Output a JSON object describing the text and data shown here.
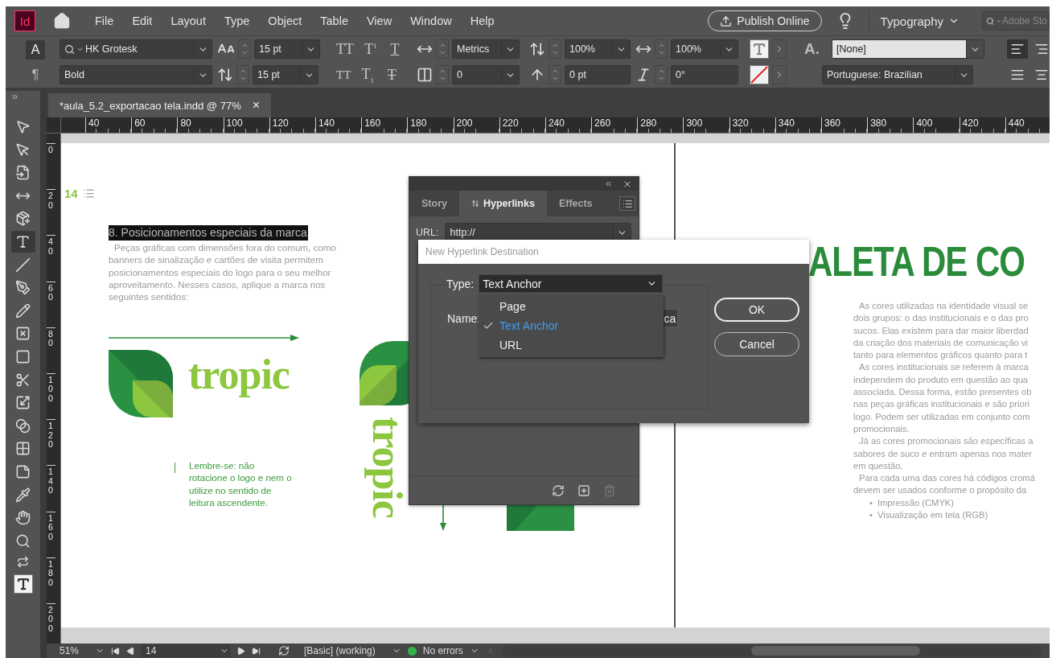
{
  "menubar": {
    "logo": "Id",
    "menus": [
      "File",
      "Edit",
      "Layout",
      "Type",
      "Object",
      "Table",
      "View",
      "Window",
      "Help"
    ],
    "publish_button": "Publish Online",
    "workspace": "Typography",
    "search": {
      "placeholder": "Adobe Sto"
    }
  },
  "control_panel": {
    "modes": [
      {
        "label": "A",
        "selected": true
      },
      {
        "label": "¶",
        "selected": false
      }
    ],
    "font_family": "HK Grotesk",
    "font_style": "Bold",
    "font_size": "15 pt",
    "leading": "15 pt",
    "type_buttons": [
      {
        "label": "TT",
        "kind": "caps"
      },
      {
        "label": "T$^{1}$",
        "kind": "super"
      },
      {
        "label": "T",
        "kind": "underline"
      },
      {
        "label": "TT",
        "kind": "smallcaps"
      },
      {
        "label": "T$_{1}$",
        "kind": "sub"
      },
      {
        "label": "T",
        "kind": "strike"
      }
    ],
    "kerning": "Metrics",
    "tracking": "0",
    "vertical_scale": "100%",
    "baseline_shift": "0 pt",
    "horizontal_scale": "100%",
    "skew": "0°",
    "style_glyph": "A.",
    "character_style": "[None]",
    "language": "Portuguese: Brazilian"
  },
  "document_tab": {
    "title": "*aula_5.2_exportacao tela.indd @ 77%",
    "close": "×"
  },
  "rulers": {
    "horizontal": [
      "40",
      "60",
      "80",
      "100",
      "120",
      "140",
      "160",
      "180",
      "200",
      "220",
      "240",
      "260",
      "280",
      "300",
      "320",
      "340",
      "360",
      "380",
      "400",
      "420",
      "440"
    ],
    "vertical": [
      "0",
      "20",
      "40",
      "60",
      "80",
      "100",
      "120",
      "140",
      "160",
      "180",
      "200"
    ]
  },
  "tools": [
    {
      "selected": false
    },
    {
      "selected": false
    },
    {
      "selected": false
    },
    {
      "selected": false
    },
    {
      "selected": false
    },
    {
      "selected": true
    },
    {
      "selected": false
    },
    {
      "selected": false
    },
    {
      "selected": false
    },
    {
      "selected": false
    },
    {
      "selected": false
    },
    {
      "selected": false
    },
    {
      "selected": false
    },
    {
      "selected": false
    },
    {
      "selected": false
    },
    {
      "selected": false
    },
    {
      "selected": false
    },
    {
      "selected": false
    },
    {
      "selected": false
    }
  ],
  "left_page": {
    "page_number": "14",
    "heading": "8. Posicionamentos especiais da marca",
    "body": "Peças gráficas com dimensões fora do comum, como banners de sinalização e cartões de visita permitem posicionamentos especiais do logo para o seu melhor aproveitamento. Nesses casos, aplique a marca nos seguintes sentidos:",
    "logo_text": "tropic",
    "vertical_logo_text": "tropic",
    "note": "Lembre-se: não rotacione o logo e nem o utilize no sentido de leitura ascendente."
  },
  "right_page": {
    "title": "ALETA DE CO",
    "paragraphs": [
      [
        "As cores utilizadas na identidade visual se",
        "dois grupos: o das institucionais e o das pro",
        "sucos. Elas existem para dar maior liberdad",
        "da criação dos materiais de comunicação vi",
        "tanto para elementos gráficos quanto para t"
      ],
      [
        "As cores institucionais se referem à marca",
        "independem do produto em questão ao qua",
        "associada. Dessa forma, estão presentes ob",
        "nas peças gráficas institucionais e são priori",
        "logo. Podem ser utilizadas em conjunto com",
        "promocionais."
      ],
      [
        "Já as cores promocionais são específicas a",
        "sabores de suco e entram apenas nos mater",
        "em questão."
      ],
      [
        "Para cada uma das cores há códigos cromá",
        "devem ser usados conforme o propósito da"
      ]
    ],
    "bullets": [
      {
        "marker": "•",
        "text": "Impressão (CMYK)"
      },
      {
        "marker": "•",
        "text": "Visualização em tela (RGB)"
      }
    ]
  },
  "panel": {
    "tabs": [
      {
        "label": "Story",
        "selected": false
      },
      {
        "label": "Hyperlinks",
        "selected": true
      },
      {
        "label": "Effects",
        "selected": false
      }
    ],
    "url_label": "URL:",
    "url": "http://"
  },
  "dialog": {
    "title": "New Hyperlink Destination",
    "type_label": "Type:",
    "type_value": "Text Anchor",
    "options": [
      {
        "label": "Page",
        "selected": false
      },
      {
        "label": "Text Anchor",
        "selected": true
      },
      {
        "label": "URL",
        "selected": false
      }
    ],
    "name_label": "Name:",
    "name_value": "ca",
    "ok": "OK",
    "cancel": "Cancel"
  },
  "status_bar": {
    "zoom": "51%",
    "page": "14",
    "style": "[Basic] (working)",
    "preflight": "No errors"
  }
}
